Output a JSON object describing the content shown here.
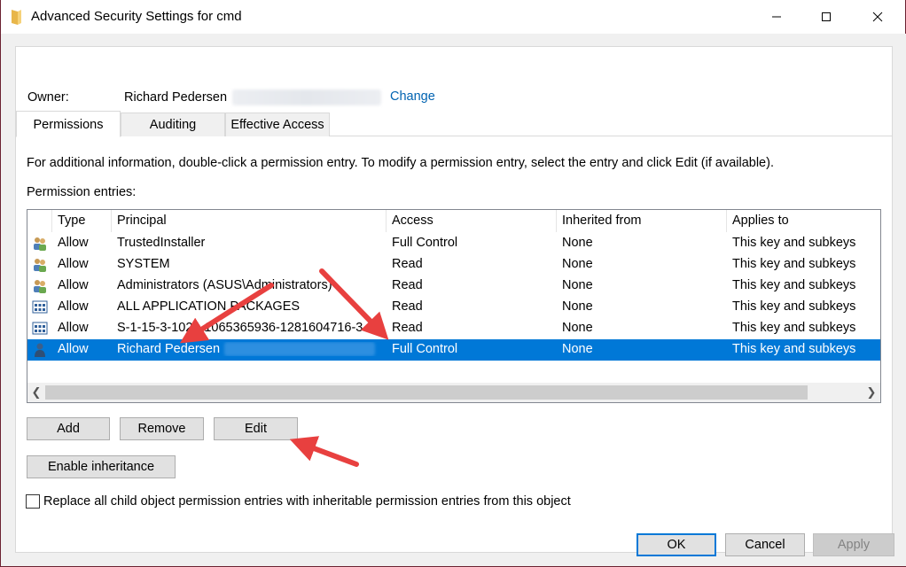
{
  "window": {
    "title": "Advanced Security Settings for cmd"
  },
  "owner": {
    "label": "Owner:",
    "name": "Richard Pedersen",
    "change_link": "Change"
  },
  "tabs": [
    {
      "label": "Permissions",
      "active": true
    },
    {
      "label": "Auditing",
      "active": false
    },
    {
      "label": "Effective Access",
      "active": false
    }
  ],
  "info_text": "For additional information, double-click a permission entry. To modify a permission entry, select the entry and click Edit (if available).",
  "entries_label": "Permission entries:",
  "table": {
    "columns": [
      "Type",
      "Principal",
      "Access",
      "Inherited from",
      "Applies to"
    ],
    "rows": [
      {
        "icon": "group-users-icon",
        "type": "Allow",
        "principal": "TrustedInstaller",
        "access": "Full Control",
        "inherited": "None",
        "applies": "This key and subkeys"
      },
      {
        "icon": "group-users-icon",
        "type": "Allow",
        "principal": "SYSTEM",
        "access": "Read",
        "inherited": "None",
        "applies": "This key and subkeys"
      },
      {
        "icon": "group-users-icon",
        "type": "Allow",
        "principal": "Administrators (ASUS\\Administrators)",
        "access": "Read",
        "inherited": "None",
        "applies": "This key and subkeys"
      },
      {
        "icon": "app-package-icon",
        "type": "Allow",
        "principal": "ALL APPLICATION PACKAGES",
        "access": "Read",
        "inherited": "None",
        "applies": "This key and subkeys"
      },
      {
        "icon": "app-package-icon",
        "type": "Allow",
        "principal": "S-1-15-3-1024-1065365936-1281604716-3...",
        "access": "Read",
        "inherited": "None",
        "applies": "This key and subkeys"
      },
      {
        "icon": "user-icon",
        "type": "Allow",
        "principal": "Richard Pedersen",
        "access": "Full Control",
        "inherited": "None",
        "applies": "This key and subkeys",
        "selected": true
      }
    ]
  },
  "buttons": {
    "add": "Add",
    "remove": "Remove",
    "edit": "Edit",
    "enable_inheritance": "Enable inheritance",
    "ok": "OK",
    "cancel": "Cancel",
    "apply": "Apply"
  },
  "checkbox": {
    "label": "Replace all child object permission entries with inheritable permission entries from this object",
    "checked": false
  },
  "colors": {
    "selection": "#0078d7",
    "link": "#0063b1",
    "annotation_arrow": "#e8403f",
    "window_border": "#6b2231"
  }
}
